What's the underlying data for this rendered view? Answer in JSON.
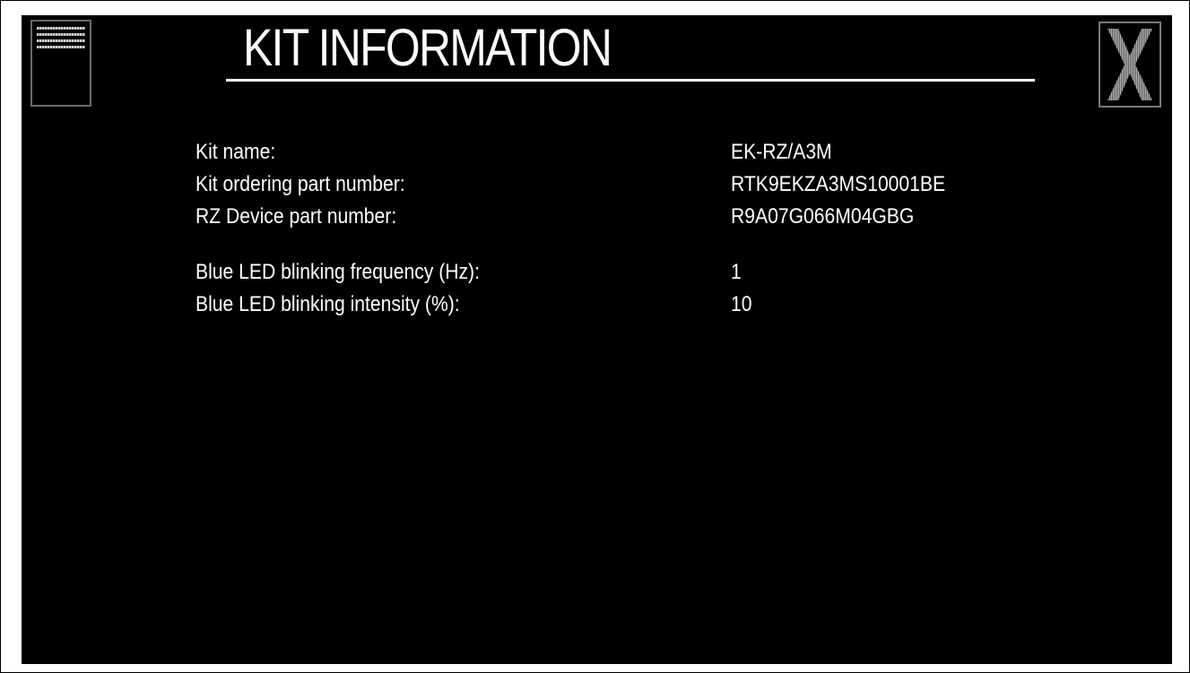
{
  "title": "KIT INFORMATION",
  "icons": {
    "menu": "menu-icon",
    "close": "close-icon"
  },
  "colors": {
    "background": "#000000",
    "text": "#ffffff",
    "button_border": "#6a6a6a",
    "close_glyph": "#9a9a9a"
  },
  "kit": [
    {
      "label": "Kit name:",
      "value": "EK-RZ/A3M"
    },
    {
      "label": "Kit ordering part number:",
      "value": "RTK9EKZA3MS10001BE"
    },
    {
      "label": "RZ Device part number:",
      "value": "R9A07G066M04GBG"
    }
  ],
  "led": [
    {
      "label": "Blue LED blinking frequency (Hz):",
      "value": "1"
    },
    {
      "label": "Blue LED blinking intensity (%):",
      "value": "10"
    }
  ]
}
